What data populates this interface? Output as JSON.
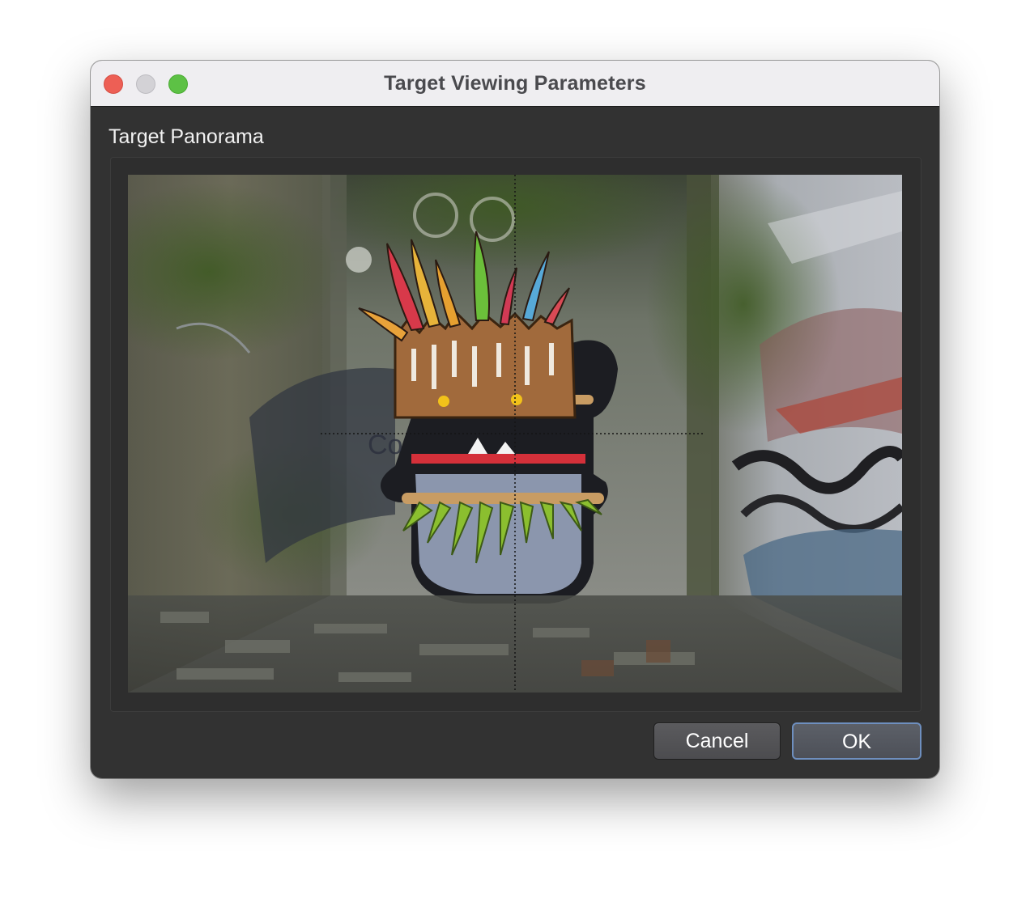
{
  "window": {
    "title": "Target Viewing Parameters"
  },
  "section": {
    "label": "Target Panorama"
  },
  "panorama": {
    "graffiti_text": "Co",
    "crosshair": "dotted"
  },
  "buttons": {
    "cancel_label": "Cancel",
    "ok_label": "OK"
  },
  "colors": {
    "window_bg": "#323232",
    "titlebar_bg": "#efeef1",
    "close": "#ed5f55",
    "minimize": "#d3d2d6",
    "zoom": "#5dc145",
    "ok_focus_ring": "#6e8fbf"
  }
}
